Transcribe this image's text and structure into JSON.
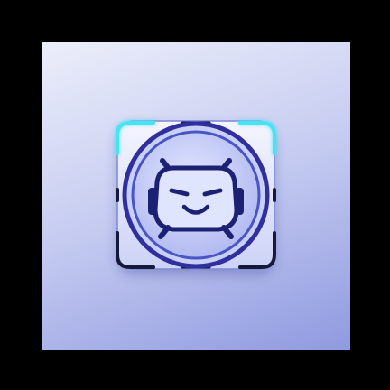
{
  "app_icon": {
    "icon_name": "robot-face-icon",
    "colors": {
      "outer_background": "#000000",
      "tile_top": "#eceefa",
      "tile_bottom": "#8f9ae0",
      "badge_fill": "#dfe3fb",
      "badge_stroke": "#151a3a",
      "ring_outer": "#2f2f9e",
      "ring_inner": "#4a54c4",
      "face_fill": "#c6cdf7",
      "feature": "#1d2174",
      "corner_glow": "#46e3f5"
    }
  }
}
